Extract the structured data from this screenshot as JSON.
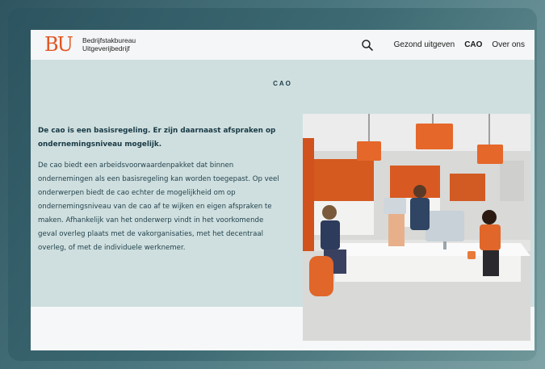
{
  "header": {
    "logo_mark": "BU",
    "logo_line1": "Bedrijfstakbureau",
    "logo_line2": "Uitgeverijbedrijf",
    "nav": [
      {
        "label": "Gezond uitgeven"
      },
      {
        "label": "CAO"
      },
      {
        "label": "Over ons"
      }
    ]
  },
  "section": {
    "title": "CAO",
    "intro": "De cao is een basisregeling. Er zijn daarnaast afspraken op ondernemingsniveau mogelijk.",
    "body": "De cao biedt een arbeidsvoorwaardenpakket dat binnen ondernemingen als een basisregeling kan worden toegepast. Op veel onderwerpen biedt de cao echter de mogelijkheid om op ondernemingsniveau van de cao af te wijken en eigen afspraken te maken. Afhankelijk van het onderwerp vindt in het voorkomende geval overleg plaats met de vakorganisaties, met het decentraal overleg, of met de individuele werknemer."
  },
  "colors": {
    "brand_orange": "#e2541f",
    "panel_bg": "#cfdfdf",
    "text_dark": "#173844"
  },
  "icons": {
    "search": "search-icon"
  }
}
